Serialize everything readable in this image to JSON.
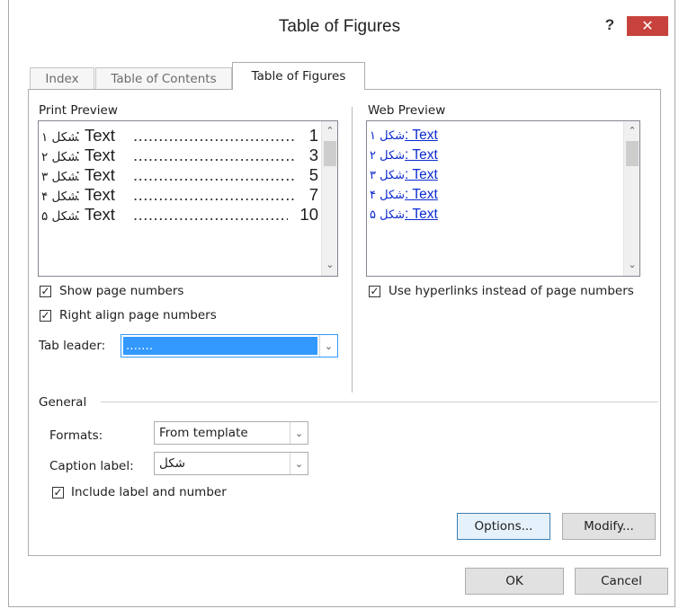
{
  "window": {
    "title": "Table of Figures",
    "help_glyph": "?",
    "close_glyph": "✕"
  },
  "tabs": [
    {
      "label": "Index"
    },
    {
      "label": "Table of Contents"
    },
    {
      "label": "Table of Figures"
    }
  ],
  "print_preview": {
    "label": "Print Preview",
    "rows": [
      {
        "caption": "شکل ۱",
        "text": ": Text",
        "page": "1"
      },
      {
        "caption": "شکل ۲",
        "text": ": Text",
        "page": "3"
      },
      {
        "caption": "شکل ۳",
        "text": ": Text",
        "page": "5"
      },
      {
        "caption": "شکل ۴",
        "text": ": Text",
        "page": "7"
      },
      {
        "caption": "شکل ۵",
        "text": ": Text",
        "page": "10"
      }
    ],
    "dots": "..........................................."
  },
  "web_preview": {
    "label": "Web Preview",
    "links": [
      {
        "caption": "شکل ۱",
        "text": ": Text"
      },
      {
        "caption": "شکل ۲",
        "text": ": Text"
      },
      {
        "caption": "شکل ۳",
        "text": ": Text"
      },
      {
        "caption": "شکل ۴",
        "text": ": Text"
      },
      {
        "caption": "شکل ۵",
        "text": ": Text"
      }
    ]
  },
  "options": {
    "show_page_numbers": {
      "label": "Show page numbers",
      "checked": true
    },
    "right_align_page_numbers": {
      "label": "Right align page numbers",
      "checked": true
    },
    "use_hyperlinks": {
      "label": "Use hyperlinks instead of page numbers",
      "checked": true
    },
    "tab_leader": {
      "label": "Tab leader:",
      "value": "......."
    }
  },
  "general": {
    "label": "General",
    "formats": {
      "label": "Formats:",
      "value": "From template"
    },
    "caption_label": {
      "label": "Caption label:",
      "value": "شکل"
    },
    "include_label": {
      "label": "Include label and number",
      "checked": true
    }
  },
  "buttons": {
    "options": "Options...",
    "modify": "Modify...",
    "ok": "OK",
    "cancel": "Cancel"
  },
  "colors": {
    "close_button": "#c7423c",
    "hyperlink": "#0b2bd1",
    "selection": "#3399ff"
  }
}
